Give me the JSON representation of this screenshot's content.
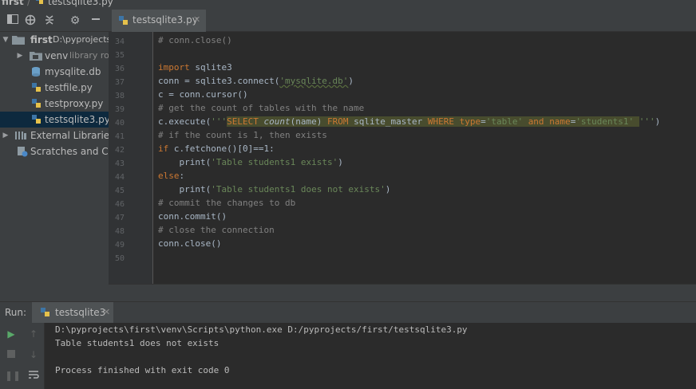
{
  "breadcrumb": {
    "project": "first",
    "separator": "/",
    "file": "testsqlite3.py"
  },
  "project_tree": [
    {
      "label": "first",
      "path": "D:\\pyprojects\\first",
      "expanded": true,
      "selected": false
    },
    {
      "label": "venv",
      "tag": "library root",
      "expanded": false,
      "selected": false
    },
    {
      "label": "mysqlite.db",
      "selected": false
    },
    {
      "label": "testfile.py",
      "selected": false
    },
    {
      "label": "testproxy.py",
      "selected": false
    },
    {
      "label": "testsqlite3.py",
      "selected": true
    },
    {
      "label": "External Libraries",
      "expanded": false,
      "selected": false
    },
    {
      "label": "Scratches and Consoles",
      "selected": false
    }
  ],
  "editor": {
    "tab_label": "testsqlite3.py",
    "line_numbers": [
      "34",
      "35",
      "36",
      "37",
      "38",
      "39",
      "40",
      "41",
      "42",
      "43",
      "44",
      "45",
      "46",
      "47",
      "48",
      "49",
      "50"
    ],
    "lines": [
      {
        "comment": "# conn.close()"
      },
      {},
      {
        "kw": "import",
        "text": " sqlite3"
      },
      {
        "text": "conn = sqlite3.connect(",
        "str": "'mysqlite.db'",
        "after": ")"
      },
      {
        "text": "c = conn.cursor()"
      },
      {
        "comment": "# get the count of tables with the name"
      },
      {
        "sql": true
      },
      {
        "comment": "# if the count is 1, then exists"
      },
      {
        "kw": "if",
        "text": " c.fetchone()[0]==1:"
      },
      {
        "indent": "    ",
        "text": "print(",
        "str": "'Table students1 exists'",
        "after": ")"
      },
      {
        "kw": "else",
        "text": ":"
      },
      {
        "indent": "    ",
        "text": "print(",
        "str": "'Table students1 does not exists'",
        "after": ")"
      },
      {
        "comment": "# commit the changes to db"
      },
      {
        "text": "conn.commit()"
      },
      {
        "comment": "# close the connection"
      },
      {
        "text": "conn.close()"
      },
      {}
    ],
    "sql_line": {
      "prefix": "c.execute(",
      "q_open": "'''",
      "k_select": "SELECT",
      "f_count": "count",
      "p_name": "(name)",
      "k_from": "FROM",
      "t_master": "sqlite_master",
      "k_where": "WHERE",
      "k_type": "type",
      "eq1": "=",
      "s_table": "'table'",
      "k_and": "and",
      "k_name": "name",
      "eq2": "=",
      "s_students": "'students1'",
      "q_close": "'''",
      "suffix": ")"
    }
  },
  "run": {
    "label": "Run:",
    "tab_label": "testsqlite3",
    "output": [
      "D:\\pyprojects\\first\\venv\\Scripts\\python.exe D:/pyprojects/first/testsqlite3.py",
      "Table students1 does not exists",
      "",
      "Process finished with exit code 0"
    ]
  },
  "colors": {
    "keyword": "#cc7832",
    "string": "#6a8759",
    "comment": "#808080",
    "selection": "#0d293e",
    "accent": "#4a88c7"
  }
}
